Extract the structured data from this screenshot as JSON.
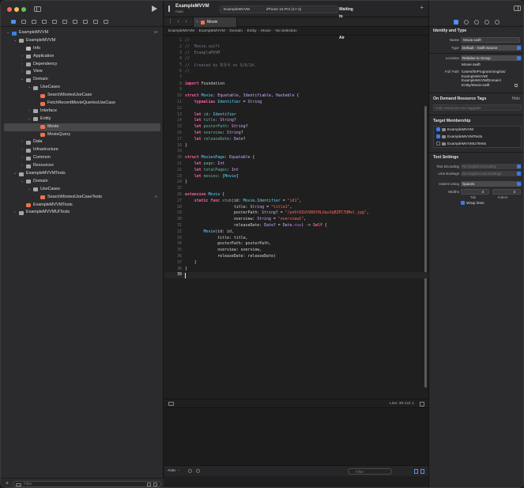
{
  "toolbar": {
    "project_title": "ExampleMVVM",
    "branch": "main",
    "scheme": "ExampleMVVM",
    "device": "iPhone 15 Pro (17.4)",
    "status": "Waiting to reconnect to iPad-Air"
  },
  "navigator": {
    "filter_placeholder": "Filter",
    "tree": [
      {
        "label": "ExampleMVVM",
        "icon": "project-icon",
        "depth": 0,
        "chevron": "v",
        "badge": "M"
      },
      {
        "label": "ExampleMVVM",
        "icon": "folder-icon",
        "depth": 1,
        "chevron": "v"
      },
      {
        "label": "Info",
        "icon": "file-icon",
        "depth": 2,
        "chevron": ""
      },
      {
        "label": "Application",
        "icon": "folder-icon",
        "depth": 2,
        "chevron": ">"
      },
      {
        "label": "Dependency",
        "icon": "folder-icon",
        "depth": 2,
        "chevron": ">"
      },
      {
        "label": "View",
        "icon": "folder-icon",
        "depth": 2,
        "chevron": ">"
      },
      {
        "label": "Domain",
        "icon": "folder-icon",
        "depth": 2,
        "chevron": "v"
      },
      {
        "label": "UseCases",
        "icon": "folder-icon",
        "depth": 3,
        "chevron": "v"
      },
      {
        "label": "SearchMoviesUseCase",
        "icon": "swift-file-icon",
        "depth": 4,
        "chevron": ""
      },
      {
        "label": "FetchRecentMovieQueriesUseCase",
        "icon": "swift-file-icon",
        "depth": 4,
        "chevron": ""
      },
      {
        "label": "Interface",
        "icon": "folder-icon",
        "depth": 3,
        "chevron": ">"
      },
      {
        "label": "Entity",
        "icon": "folder-icon",
        "depth": 3,
        "chevron": "v"
      },
      {
        "label": "Movie",
        "icon": "swift-file-icon",
        "depth": 4,
        "chevron": "",
        "selected": true
      },
      {
        "label": "MovieQuery",
        "icon": "swift-file-icon",
        "depth": 4,
        "chevron": ""
      },
      {
        "label": "Data",
        "icon": "folder-icon",
        "depth": 2,
        "chevron": ">"
      },
      {
        "label": "Infrastructure",
        "icon": "folder-icon",
        "depth": 2,
        "chevron": ">"
      },
      {
        "label": "Common",
        "icon": "folder-icon",
        "depth": 2,
        "chevron": ">"
      },
      {
        "label": "Resources",
        "icon": "folder-icon",
        "depth": 2,
        "chevron": ">"
      },
      {
        "label": "ExampleMVVMTests",
        "icon": "folder-icon",
        "depth": 1,
        "chevron": "v"
      },
      {
        "label": "Domain",
        "icon": "folder-icon",
        "depth": 2,
        "chevron": "v"
      },
      {
        "label": "UseCases",
        "icon": "folder-icon",
        "depth": 3,
        "chevron": "v"
      },
      {
        "label": "SearchMoviesUseCaseTests",
        "icon": "swift-file-icon",
        "depth": 4,
        "chevron": "",
        "badge": "A"
      },
      {
        "label": "ExampleMVVMTests",
        "icon": "swift-file-icon",
        "depth": 2,
        "chevron": ""
      },
      {
        "label": "ExampleMVVMUITests",
        "icon": "folder-icon",
        "depth": 1,
        "chevron": ">"
      }
    ]
  },
  "editor": {
    "tab_label": "Movie",
    "jumpbar": [
      "ExampleMVVM",
      "ExampleMVVM",
      "Domain",
      "Entity",
      "Movie",
      "No Selection"
    ],
    "cursor_status": "Line: 39  Col: 1",
    "current_line": 39,
    "lines": [
      [
        {
          "c": "cm",
          "t": "//"
        }
      ],
      [
        {
          "c": "cm",
          "t": "//  Movie.swift"
        }
      ],
      [
        {
          "c": "cm",
          "t": "//  ExampleMVVM"
        }
      ],
      [
        {
          "c": "cm",
          "t": "//"
        }
      ],
      [
        {
          "c": "cm",
          "t": "//  Created by 최유식 on 9/8/24."
        }
      ],
      [
        {
          "c": "cm",
          "t": "//"
        }
      ],
      [],
      [
        {
          "c": "kw",
          "t": "import"
        },
        {
          "c": "",
          "t": " Foundation"
        }
      ],
      [],
      [
        {
          "c": "kw",
          "t": "struct"
        },
        {
          "c": "",
          "t": " "
        },
        {
          "c": "ty",
          "t": "Movie"
        },
        {
          "c": "",
          "t": ": "
        },
        {
          "c": "ty2",
          "t": "Equatable"
        },
        {
          "c": "",
          "t": ", "
        },
        {
          "c": "ty2",
          "t": "Identifiable"
        },
        {
          "c": "",
          "t": ", "
        },
        {
          "c": "ty2",
          "t": "Hashable"
        },
        {
          "c": "",
          "t": " {"
        }
      ],
      [
        {
          "c": "",
          "t": "    "
        },
        {
          "c": "kw",
          "t": "typealias"
        },
        {
          "c": "",
          "t": " "
        },
        {
          "c": "ty",
          "t": "Identifier"
        },
        {
          "c": "",
          "t": " = "
        },
        {
          "c": "ty2",
          "t": "String"
        }
      ],
      [],
      [
        {
          "c": "",
          "t": "    "
        },
        {
          "c": "kw",
          "t": "let"
        },
        {
          "c": "",
          "t": " "
        },
        {
          "c": "nm2",
          "t": "id"
        },
        {
          "c": "",
          "t": ": "
        },
        {
          "c": "ty",
          "t": "Identifier"
        }
      ],
      [
        {
          "c": "",
          "t": "    "
        },
        {
          "c": "kw",
          "t": "let"
        },
        {
          "c": "",
          "t": " "
        },
        {
          "c": "nm2",
          "t": "title"
        },
        {
          "c": "",
          "t": ": "
        },
        {
          "c": "ty2",
          "t": "String"
        },
        {
          "c": "",
          "t": "?"
        }
      ],
      [
        {
          "c": "",
          "t": "    "
        },
        {
          "c": "kw",
          "t": "let"
        },
        {
          "c": "",
          "t": " "
        },
        {
          "c": "nm2",
          "t": "posterPath"
        },
        {
          "c": "",
          "t": ": "
        },
        {
          "c": "ty2",
          "t": "String"
        },
        {
          "c": "",
          "t": "?"
        }
      ],
      [
        {
          "c": "",
          "t": "    "
        },
        {
          "c": "kw",
          "t": "let"
        },
        {
          "c": "",
          "t": " "
        },
        {
          "c": "nm2",
          "t": "overview"
        },
        {
          "c": "",
          "t": ": "
        },
        {
          "c": "ty2",
          "t": "String"
        },
        {
          "c": "",
          "t": "?"
        }
      ],
      [
        {
          "c": "",
          "t": "    "
        },
        {
          "c": "kw",
          "t": "let"
        },
        {
          "c": "",
          "t": " "
        },
        {
          "c": "nm2",
          "t": "releaseDate"
        },
        {
          "c": "",
          "t": ": "
        },
        {
          "c": "ty2",
          "t": "Date"
        },
        {
          "c": "",
          "t": "?"
        }
      ],
      [
        {
          "c": "",
          "t": "}"
        }
      ],
      [],
      [
        {
          "c": "kw",
          "t": "struct"
        },
        {
          "c": "",
          "t": " "
        },
        {
          "c": "ty",
          "t": "MoviesPage"
        },
        {
          "c": "",
          "t": ": "
        },
        {
          "c": "ty2",
          "t": "Equatable"
        },
        {
          "c": "",
          "t": " {"
        }
      ],
      [
        {
          "c": "",
          "t": "    "
        },
        {
          "c": "kw",
          "t": "let"
        },
        {
          "c": "",
          "t": " "
        },
        {
          "c": "nm2",
          "t": "page"
        },
        {
          "c": "",
          "t": ": "
        },
        {
          "c": "ty2",
          "t": "Int"
        }
      ],
      [
        {
          "c": "",
          "t": "    "
        },
        {
          "c": "kw",
          "t": "let"
        },
        {
          "c": "",
          "t": " "
        },
        {
          "c": "nm2",
          "t": "totalPages"
        },
        {
          "c": "",
          "t": ": "
        },
        {
          "c": "ty2",
          "t": "Int"
        }
      ],
      [
        {
          "c": "",
          "t": "    "
        },
        {
          "c": "kw",
          "t": "let"
        },
        {
          "c": "",
          "t": " "
        },
        {
          "c": "nm2",
          "t": "movies"
        },
        {
          "c": "",
          "t": ": ["
        },
        {
          "c": "ty",
          "t": "Movie"
        },
        {
          "c": "",
          "t": "]"
        }
      ],
      [
        {
          "c": "",
          "t": "}"
        }
      ],
      [],
      [
        {
          "c": "kw",
          "t": "extension"
        },
        {
          "c": "",
          "t": " "
        },
        {
          "c": "ty",
          "t": "Movie"
        },
        {
          "c": "",
          "t": " {"
        }
      ],
      [
        {
          "c": "",
          "t": "    "
        },
        {
          "c": "kw",
          "t": "static"
        },
        {
          "c": "",
          "t": " "
        },
        {
          "c": "kw",
          "t": "func"
        },
        {
          "c": "",
          "t": " "
        },
        {
          "c": "nm2",
          "t": "stub"
        },
        {
          "c": "",
          "t": "(id: "
        },
        {
          "c": "ty",
          "t": "Movie"
        },
        {
          "c": "",
          "t": "."
        },
        {
          "c": "ty",
          "t": "Identifier"
        },
        {
          "c": "",
          "t": " = "
        },
        {
          "c": "st",
          "t": "\"id1\""
        },
        {
          "c": "",
          "t": ","
        }
      ],
      [
        {
          "c": "",
          "t": "                     title: "
        },
        {
          "c": "ty2",
          "t": "String"
        },
        {
          "c": "",
          "t": " = "
        },
        {
          "c": "st",
          "t": "\"title1\""
        },
        {
          "c": "",
          "t": ","
        }
      ],
      [
        {
          "c": "",
          "t": "                     posterPath: "
        },
        {
          "c": "ty2",
          "t": "String"
        },
        {
          "c": "",
          "t": "? = "
        },
        {
          "c": "st",
          "t": "\"/pnOrDIb5908f0LUqxXqBZPC7QMel.jpg\""
        },
        {
          "c": "",
          "t": ","
        }
      ],
      [
        {
          "c": "",
          "t": "                     overview: "
        },
        {
          "c": "ty2",
          "t": "String"
        },
        {
          "c": "",
          "t": " = "
        },
        {
          "c": "st",
          "t": "\"overview1\""
        },
        {
          "c": "",
          "t": ","
        }
      ],
      [
        {
          "c": "",
          "t": "                     releaseDate: "
        },
        {
          "c": "ty2",
          "t": "Date"
        },
        {
          "c": "",
          "t": "? = "
        },
        {
          "c": "ty2",
          "t": "Date"
        },
        {
          "c": "",
          "t": "."
        },
        {
          "c": "pr",
          "t": "now"
        },
        {
          "c": "",
          "t": ") -> "
        },
        {
          "c": "kw",
          "t": "Self"
        },
        {
          "c": "",
          "t": " {"
        }
      ],
      [
        {
          "c": "",
          "t": "        "
        },
        {
          "c": "ty",
          "t": "Movie"
        },
        {
          "c": "",
          "t": "(id: id,"
        }
      ],
      [
        {
          "c": "",
          "t": "              title: title,"
        }
      ],
      [
        {
          "c": "",
          "t": "              posterPath: posterPath,"
        }
      ],
      [
        {
          "c": "",
          "t": "              overview: overview,"
        }
      ],
      [
        {
          "c": "",
          "t": "              releaseDate: releaseDate)"
        }
      ],
      [
        {
          "c": "",
          "t": "    }"
        }
      ],
      [
        {
          "c": "",
          "t": "}"
        }
      ],
      []
    ]
  },
  "debug": {
    "auto_label": "Auto",
    "filter_placeholder": "Filter"
  },
  "inspector": {
    "identity_title": "Identity and Type",
    "name_label": "Name",
    "name_value": "Movie.swift",
    "type_label": "Type",
    "type_value": "Default - Swift Source",
    "location_label": "Location",
    "location_value": "Relative to Group",
    "location_file": "Movie.swift",
    "fullpath_label": "Full Path",
    "fullpath_lines": [
      "/Users/fe/Programming/ios/",
      "ExampleMVVM/",
      "ExampleMVVM/Domain/",
      "Entity/Movie.swift"
    ],
    "on_demand_title": "On Demand Resource Tags",
    "on_demand_hide": "Hide",
    "on_demand_placeholder": "Only resources are taggable",
    "membership_title": "Target Membership",
    "targets": [
      {
        "label": "ExampleMVVM",
        "checked": true
      },
      {
        "label": "ExampleMVVMTests",
        "checked": true
      },
      {
        "label": "ExampleMVVMUITests",
        "checked": false
      }
    ],
    "text_settings_title": "Text Settings",
    "encoding_label": "Text Encoding",
    "encoding_value": "No Explicit Encoding",
    "line_endings_label": "Line Endings",
    "line_endings_value": "No Explicit Line Endings",
    "indent_label": "Indent Using",
    "indent_value": "Spaces",
    "widths_label": "Widths",
    "tab_width": "4",
    "indent_width": "4",
    "tab_sub": "Tab",
    "indent_sub": "Indent",
    "wrap_label": "Wrap lines"
  },
  "colors": {
    "accent": "#3a7be8",
    "keyword": "#fc5fa3",
    "comment": "#6c7986",
    "string": "#fc6a5d",
    "type": "#5dd8ff"
  }
}
